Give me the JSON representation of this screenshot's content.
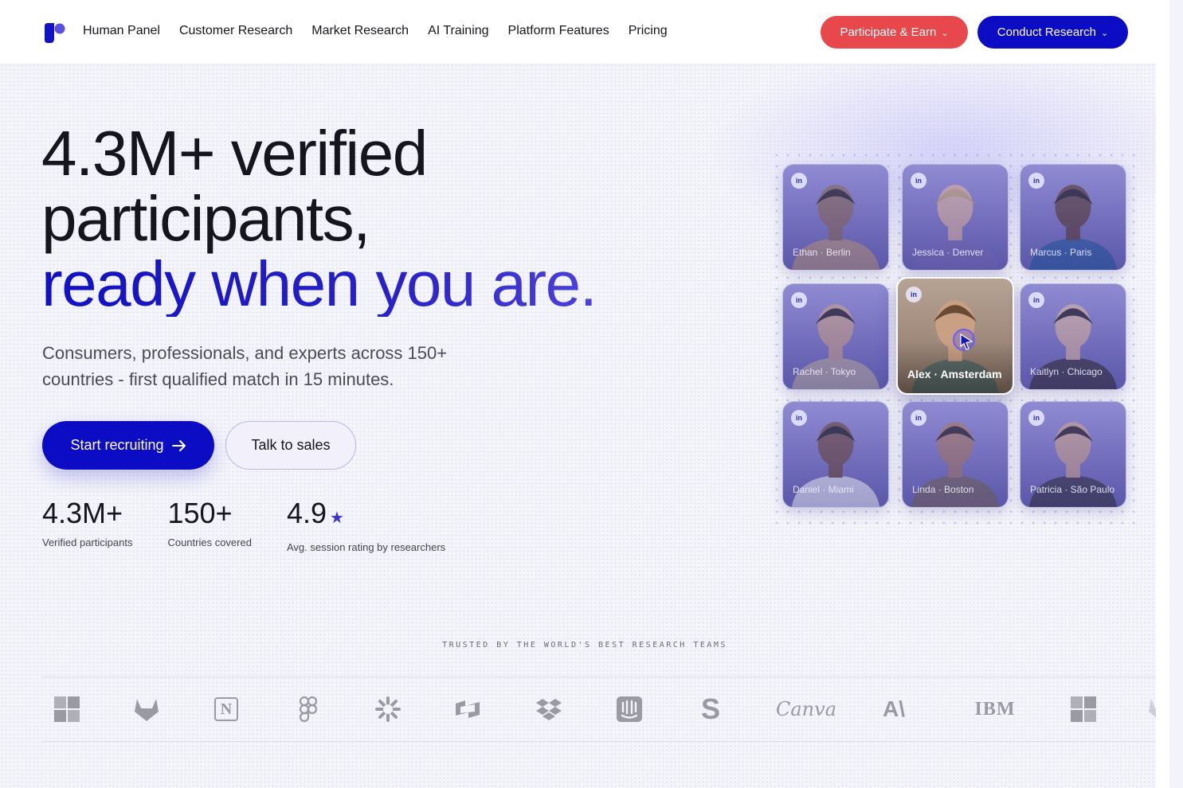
{
  "nav": {
    "logo_icon": "brand-logo-icon",
    "links": [
      "Human Panel",
      "Customer Research",
      "Market Research",
      "AI Training",
      "Platform Features",
      "Pricing"
    ],
    "participate_label": "Participate & Earn",
    "conduct_label": "Conduct Research"
  },
  "hero": {
    "headline_line1": "4.3M+ verified",
    "headline_line2": "participants,",
    "headline_line3": "ready when you are.",
    "subtitle": "Consumers, professionals, and experts across 150+ countries - first qualified match in 15 minutes.",
    "cta_primary": "Start recruiting",
    "cta_secondary": "Talk to sales"
  },
  "stats": [
    {
      "value": "4.3M+",
      "label": "Verified participants"
    },
    {
      "value": "150+",
      "label": "Countries covered"
    },
    {
      "value": "4.9",
      "label": "Avg. session rating by researchers",
      "star": "★"
    }
  ],
  "people": [
    {
      "label": "Ethan · Berlin",
      "linkedin": "in"
    },
    {
      "label": "Jessica · Denver",
      "linkedin": "in"
    },
    {
      "label": "Marcus · Paris",
      "linkedin": "in"
    },
    {
      "label": "Rachel · Tokyo",
      "linkedin": "in"
    },
    {
      "label": "Alex · Amsterdam",
      "linkedin": "in"
    },
    {
      "label": "Kaitlyn · Chicago",
      "linkedin": "in"
    },
    {
      "label": "Daniel · Miami",
      "linkedin": "in"
    },
    {
      "label": "Linda · Boston",
      "linkedin": "in"
    },
    {
      "label": "Patricia · São Paulo",
      "linkedin": "in"
    }
  ],
  "trusted": {
    "heading": "TRUSTED BY THE WORLD'S BEST RESEARCH TEAMS",
    "logos": [
      {
        "icon": "microsoft-logo-icon"
      },
      {
        "icon": "gitlab-logo-icon"
      },
      {
        "icon": "notion-logo-icon",
        "text": "N"
      },
      {
        "icon": "figma-logo-icon"
      },
      {
        "icon": "zapier-logo-icon"
      },
      {
        "icon": "webflow-logo-icon"
      },
      {
        "icon": "dropbox-logo-icon"
      },
      {
        "icon": "intercom-logo-icon"
      },
      {
        "icon": "stripe-logo-icon",
        "text": "S"
      },
      {
        "icon": "canva-logo-icon",
        "text": "Canva"
      },
      {
        "icon": "anthropic-logo-icon",
        "text": "A\\"
      },
      {
        "icon": "ibm-logo-icon",
        "text": "IBM"
      },
      {
        "icon": "microsoft-logo-icon"
      },
      {
        "icon": "gitlab-logo-icon"
      }
    ]
  },
  "colors": {
    "brand_blue": "#0c0cc4",
    "earn_red": "#e8474b",
    "accent_gradient_end": "#5e52e6",
    "logo_gray": "#9a9aa3"
  }
}
